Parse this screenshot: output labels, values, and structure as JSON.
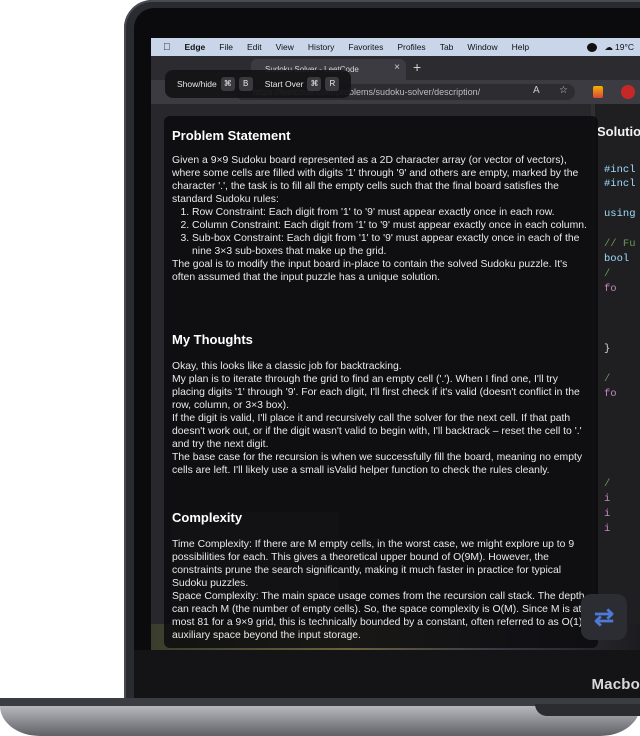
{
  "menubar": {
    "apple_glyph": "",
    "items": [
      "Edge",
      "File",
      "Edit",
      "View",
      "History",
      "Favorites",
      "Profiles",
      "Tab",
      "Window",
      "Help"
    ],
    "temperature": "19°C"
  },
  "browser": {
    "tab_title": "Sudoku Solver - LeetCode",
    "url": "https://leetcode.com/problems/sudoku-solver/description/"
  },
  "shortcut_bar": {
    "show_hide_label": "Show/hide",
    "show_hide_key1": "⌘",
    "show_hide_key2": "B",
    "start_over_label": "Start Over",
    "start_over_key1": "⌘",
    "start_over_key2": "R"
  },
  "overlay": {
    "problem_heading": "Problem Statement",
    "problem_intro": "Given a 9×9 Sudoku board represented as a 2D character array (or vector of vectors), where some cells are filled with digits '1' through '9' and others are empty, marked by the character '.', the task is to fill all the empty cells such that the final board satisfies the standard Sudoku rules:",
    "rules": [
      "Row Constraint: Each digit from '1' to '9' must appear exactly once in each row.",
      "Column Constraint: Each digit from '1' to '9' must appear exactly once in each column.",
      "Sub-box Constraint: Each digit from '1' to '9' must appear exactly once in each of the nine 3×3 sub-boxes that make up the grid."
    ],
    "problem_outro": "The goal is to modify the input board in-place to contain the solved Sudoku puzzle. It's often assumed that the input puzzle has a unique solution.",
    "thoughts_heading": "My Thoughts",
    "thoughts": [
      "Okay, this looks like a classic job for backtracking.",
      "My plan is to iterate through the grid to find an empty cell ('.'). When I find one, I'll try placing digits '1' through '9'. For each digit, I'll first check if it's valid (doesn't conflict in the row, column, or 3×3 box).",
      "If the digit is valid, I'll place it and recursively call the solver for the next cell. If that path doesn't work out, or if the digit wasn't valid to begin with, I'll backtrack – reset the cell to '.' and try the next digit.",
      "The base case for the recursion is when we successfully fill the board, meaning no empty cells are left. I'll likely use a small isValid helper function to check the rules cleanly."
    ],
    "complexity_heading": "Complexity",
    "complexity": [
      "Time Complexity: If there are M empty cells, in the worst case, we might explore up to 9 possibilities for each. This gives a theoretical upper bound of O(9M). However, the constraints prune the search significantly, making it much faster in practice for typical Sudoku puzzles.",
      "Space Complexity: The main space usage comes from the recursion call stack. The depth can reach M (the number of empty cells). So, the space complexity is O(M). Since M is at most 81 for a 9×9 grid, this is technically bounded by a constant, often referred to as O(1) auxiliary space beyond the input storage."
    ]
  },
  "side_panel": {
    "heading": "Solutio",
    "code_lines": [
      "#incl",
      "#incl",
      "",
      "using",
      "",
      "// Fu",
      "bool",
      "    /",
      "    fo",
      "",
      "",
      "    }",
      "",
      "    /",
      "    fo",
      "",
      "",
      "    }",
      "",
      "    /",
      "    i",
      "    i",
      "    i",
      "",
      "",
      "",
      "",
      "}"
    ]
  },
  "device": {
    "brand": "Macbo"
  }
}
